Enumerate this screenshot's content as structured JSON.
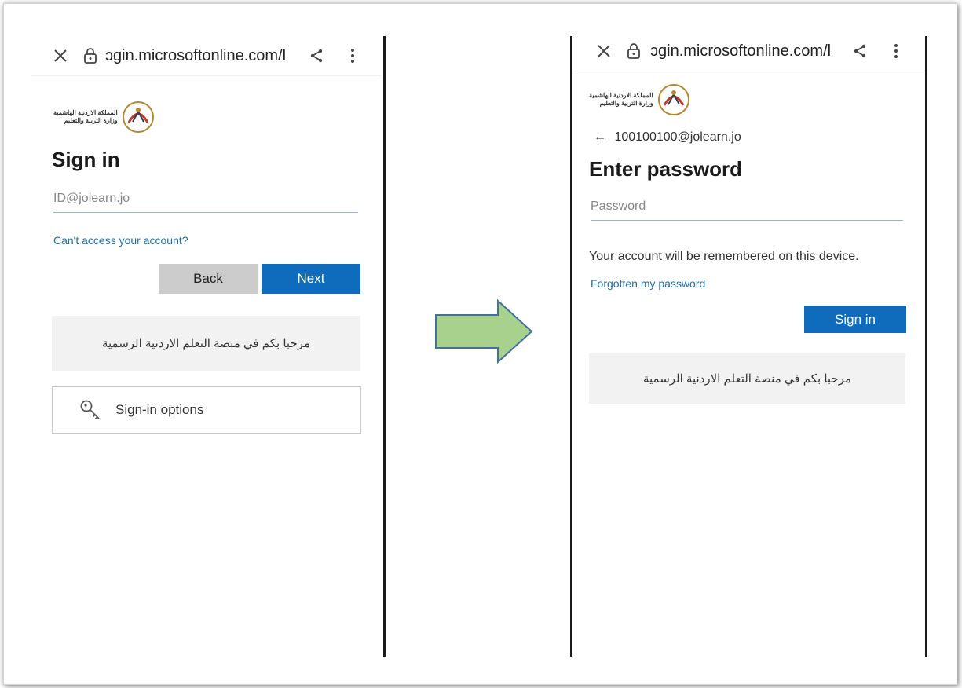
{
  "left_screen": {
    "url": "ᴐgin.microsoftonline.com/l",
    "logo_text_line1": "المملكة الاردنية الهاشمية",
    "logo_text_line2": "وزارة التربية والتعليم",
    "title": "Sign in",
    "email_placeholder": "ID@jolearn.jo",
    "cant_access_link": "Can't access your account?",
    "back_label": "Back",
    "next_label": "Next",
    "banner_text": "مرحبا بكم في منصة التعلم الاردنية الرسمية",
    "signin_options_label": "Sign-in options"
  },
  "right_screen": {
    "url": "ᴐgin.microsoftonline.com/l",
    "logo_text_line1": "المملكة الاردنية الهاشمية",
    "logo_text_line2": "وزارة التربية والتعليم",
    "back_arrow": "←",
    "account_email": "100100100@jolearn.jo",
    "title": "Enter password",
    "password_placeholder": "Password",
    "remember_text": "Your account will be remembered on this device.",
    "forgot_link": "Forgotten my password",
    "signin_label": "Sign in",
    "banner_text": "مرحبا بكم في منصة التعلم الاردنية الرسمية"
  },
  "colors": {
    "primary_button": "#0f6cbd",
    "secondary_button": "#cccccc",
    "link": "#1f6fa8",
    "arrow_fill": "#a9d18e",
    "arrow_stroke": "#41719c"
  }
}
